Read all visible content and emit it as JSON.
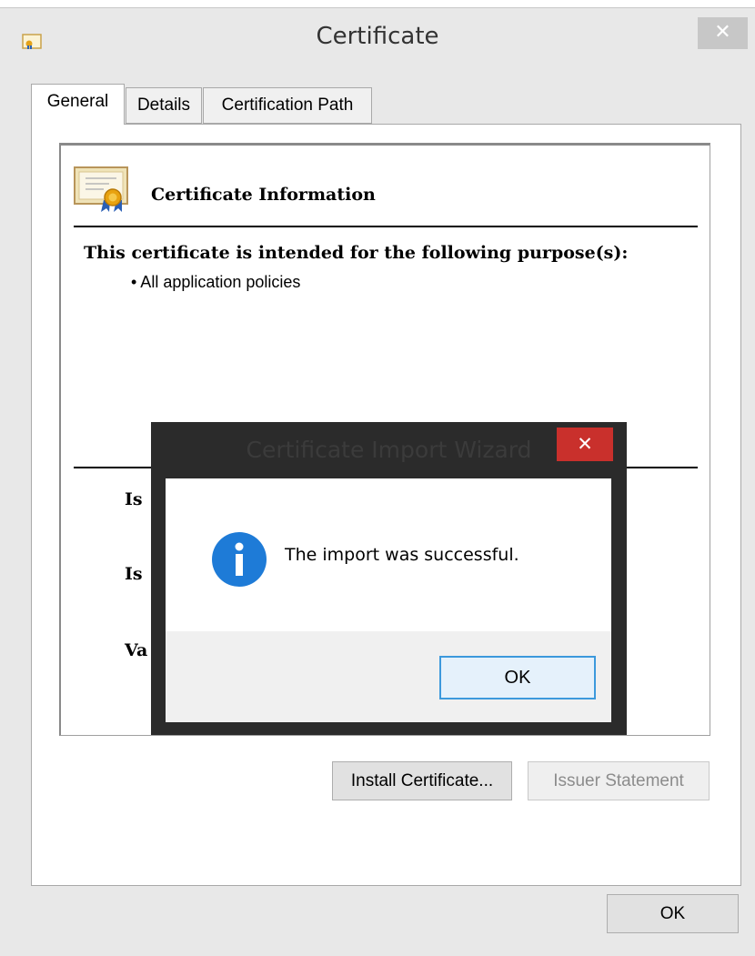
{
  "window": {
    "title": "Certificate",
    "close_glyph": "✕"
  },
  "tabs": [
    {
      "label": "General",
      "active": true
    },
    {
      "label": "Details",
      "active": false
    },
    {
      "label": "Certification Path",
      "active": false
    }
  ],
  "general": {
    "info_heading": "Certificate Information",
    "purpose_heading": "This certificate is intended for the following purpose(s):",
    "purposes": [
      "• All application policies"
    ],
    "partial_fields": [
      "Is",
      "Is",
      "Va"
    ]
  },
  "buttons": {
    "install_certificate": "Install Certificate...",
    "issuer_statement": "Issuer Statement",
    "ok": "OK"
  },
  "dialog": {
    "title": "Certificate Import Wizard",
    "close_glyph": "✕",
    "message": "The import was successful.",
    "ok": "OK",
    "icon": "info-icon"
  },
  "colors": {
    "dialog_frame": "#2b2b2b",
    "dialog_close": "#c9302c",
    "info_blue": "#1e7bd7",
    "ok_focus_border": "#3c99dc"
  }
}
